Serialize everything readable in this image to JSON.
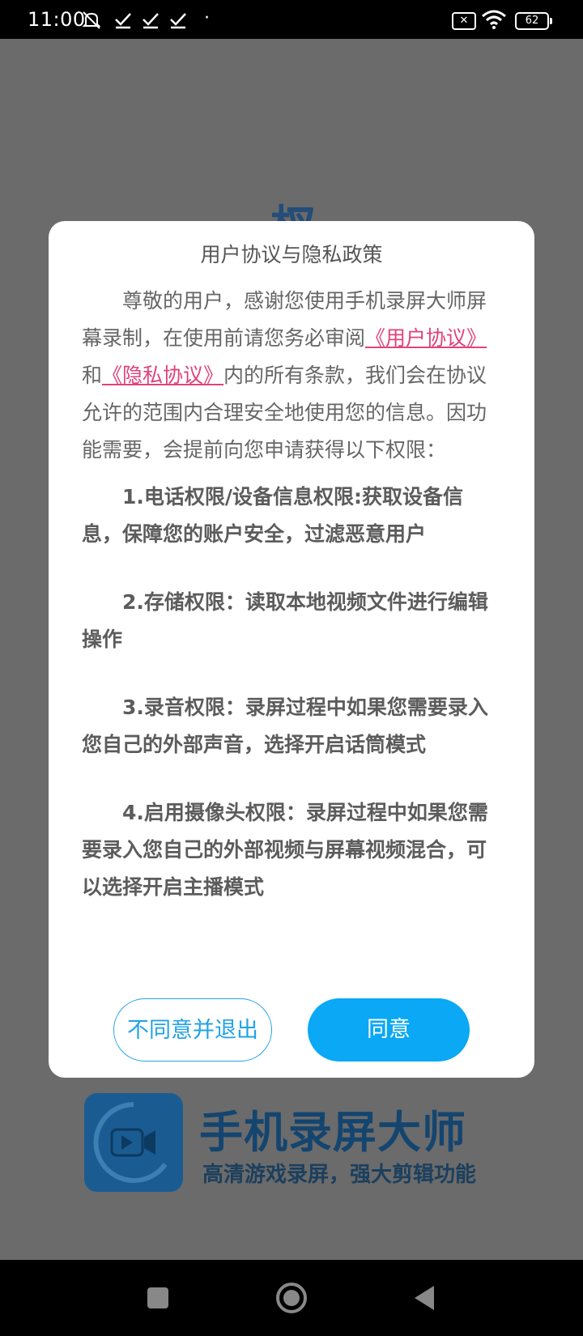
{
  "status_bar": {
    "time": "11:00",
    "battery": "62",
    "icons": [
      "bell-off-icon",
      "check-icon",
      "check-icon",
      "check-icon",
      "dot-icon",
      "sim-x-icon",
      "wifi-icon",
      "battery-icon"
    ]
  },
  "background": {
    "partial_title": "杈",
    "brand_name": "手机录屏大师",
    "slogan": "高清游戏录屏，强大剪辑功能"
  },
  "dialog": {
    "title": "用户协议与隐私政策",
    "intro_before": "尊敬的用户，感谢您使用手机录屏大师屏幕录制，在使用前请您务必审阅",
    "user_agreement_link": "《用户协议》",
    "and": "和",
    "privacy_link": "《隐私协议》",
    "intro_after": "内的所有条款，我们会在协议允许的范围内合理安全地使用您的信息。因功能需要，会提前向您申请获得以下权限：",
    "permissions": [
      "1.电话权限/设备信息权限:获取设备信息，保障您的账户安全，过滤恶意用户",
      "2.存储权限：读取本地视频文件进行编辑操作",
      "3.录音权限：录屏过程中如果您需要录入您自己的外部声音，选择开启话筒模式",
      "4.启用摄像头权限：录屏过程中如果您需要录入您自己的外部视频与屏幕视频混合，可以选择开启主播模式"
    ],
    "decline_label": "不同意并退出",
    "agree_label": "同意"
  },
  "colors": {
    "accent": "#0aa8f5",
    "link": "#e0437a",
    "overlay": "#6b6b6b"
  }
}
